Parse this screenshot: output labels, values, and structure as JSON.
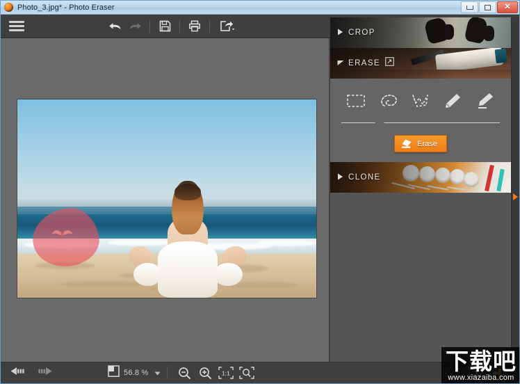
{
  "window": {
    "title": "Photo_3.jpg* - Photo Eraser",
    "app_icon": "app-logo-icon",
    "controls": {
      "minimize": "minimize-icon",
      "maximize": "maximize-icon",
      "close": "✕"
    }
  },
  "toolbar": {
    "menu_label": "menu-icon",
    "items": [
      {
        "name": "undo",
        "icon": "undo-arrow-icon",
        "enabled": true
      },
      {
        "name": "redo",
        "icon": "redo-arrow-icon",
        "enabled": false
      },
      {
        "name": "save",
        "icon": "floppy-disk-icon",
        "enabled": true
      },
      {
        "name": "print",
        "icon": "printer-icon",
        "enabled": true
      },
      {
        "name": "share",
        "icon": "share-export-icon",
        "enabled": true
      }
    ]
  },
  "canvas": {
    "image_name": "Photo_3.jpg",
    "description": "Woman in a white dress sitting in lotus pose on a beach facing the ocean",
    "selection": {
      "name": "erase-selection-region",
      "color": "#e8505c",
      "covers": "seagull"
    }
  },
  "panel": {
    "sections": [
      {
        "id": "crop",
        "label": "CROP",
        "expanded": false,
        "arrow": "chevron-right-icon"
      },
      {
        "id": "erase",
        "label": "ERASE",
        "expanded": true,
        "arrow": "chevron-down-icon",
        "tag_icon": "open-in-new-icon"
      },
      {
        "id": "clone",
        "label": "CLONE",
        "expanded": false,
        "arrow": "chevron-right-icon"
      }
    ],
    "erase_tools": [
      {
        "name": "rectangle-select-tool",
        "icon": "dashed-rectangle-icon",
        "selected": false
      },
      {
        "name": "lasso-select-tool",
        "icon": "dashed-lasso-icon",
        "selected": true
      },
      {
        "name": "polygon-select-tool",
        "icon": "dashed-polygon-icon",
        "selected": false
      },
      {
        "name": "brush-tool",
        "icon": "brush-icon",
        "selected": false
      },
      {
        "name": "brush-line-tool",
        "icon": "brush-line-icon",
        "selected": false
      }
    ],
    "erase_button": {
      "label": "Erase",
      "icon": "eraser-icon",
      "color": "#ef7d14"
    },
    "collapse_handle": "collapse-panel-arrow-icon"
  },
  "bottombar": {
    "nav": [
      {
        "name": "previous-image",
        "icon": "arrow-left-icon",
        "enabled": true
      },
      {
        "name": "next-image",
        "icon": "arrow-right-icon",
        "enabled": false
      }
    ],
    "zoom_value": "56.8 %",
    "zoom_icon": "fit-page-icon",
    "zoom_dropdown": "chevron-down-icon",
    "buttons": [
      {
        "name": "zoom-out",
        "icon": "magnifier-minus-icon"
      },
      {
        "name": "zoom-in",
        "icon": "magnifier-plus-icon"
      },
      {
        "name": "actual-size",
        "icon": "one-to-one-icon",
        "label": "1:1"
      },
      {
        "name": "fit-to-window",
        "icon": "magnifier-fit-icon"
      }
    ],
    "right_buttons": [
      {
        "name": "load-image-button",
        "icon": "import-image-icon",
        "active": false
      },
      {
        "name": "export-image-button",
        "icon": "export-door-icon",
        "active": true
      }
    ]
  },
  "watermark": {
    "logo": "下载吧",
    "url": "www.xiazaiba.com"
  }
}
